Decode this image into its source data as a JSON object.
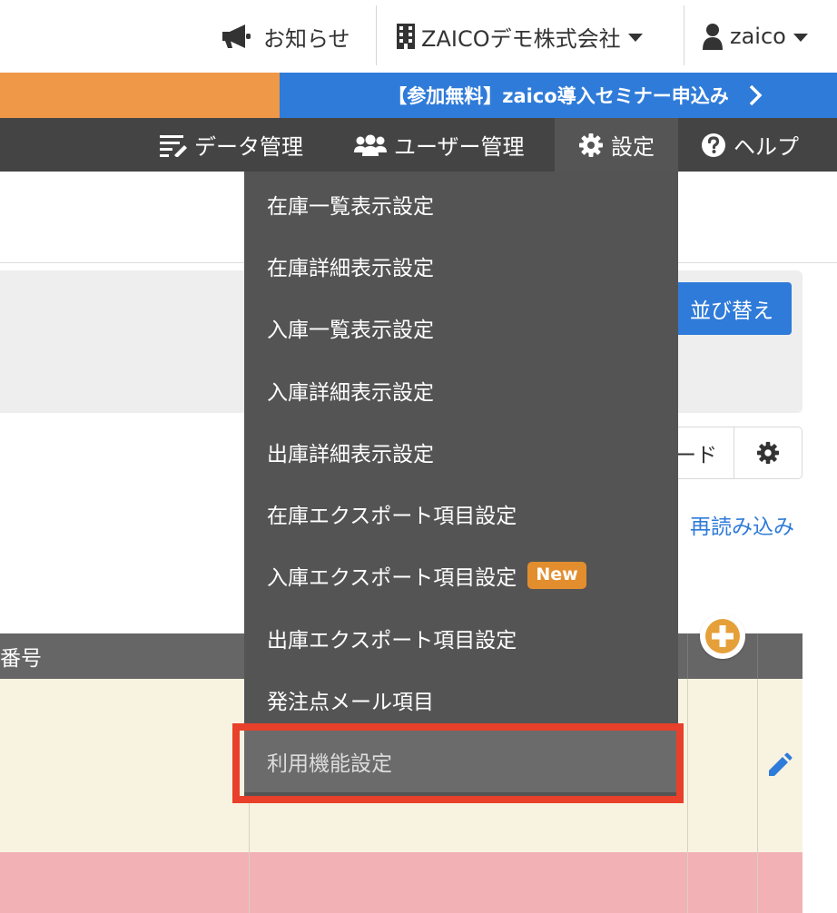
{
  "topbar": {
    "notice_label": "お知らせ",
    "company_label": "ZAICOデモ株式会社",
    "user_label": "zaico"
  },
  "banner": {
    "text": "【参加無料】zaico導入セミナー申込み"
  },
  "nav": {
    "data_label": "データ管理",
    "users_label": "ユーザー管理",
    "settings_label": "設定",
    "help_label": "ヘルプ"
  },
  "toolbar": {
    "sort_label": "並び替え",
    "mode_label_partial": "ード",
    "reload_label": "再読み込み"
  },
  "table": {
    "header_partial": "番号"
  },
  "settings_menu": {
    "items": [
      {
        "label": "在庫一覧表示設定"
      },
      {
        "label": "在庫詳細表示設定"
      },
      {
        "label": "入庫一覧表示設定"
      },
      {
        "label": "入庫詳細表示設定"
      },
      {
        "label": "出庫詳細表示設定"
      },
      {
        "label": "在庫エクスポート項目設定"
      },
      {
        "label": "入庫エクスポート項目設定",
        "badge": "New"
      },
      {
        "label": "出庫エクスポート項目設定"
      },
      {
        "label": "発注点メール項目"
      },
      {
        "label": "利用機能設定",
        "highlighted": true
      }
    ]
  },
  "colors": {
    "nav_bg": "#444444",
    "banner_orange": "#ee9848",
    "banner_blue": "#2f7bd9",
    "highlight_box": "#e8402a",
    "new_badge": "#e38e2e"
  }
}
